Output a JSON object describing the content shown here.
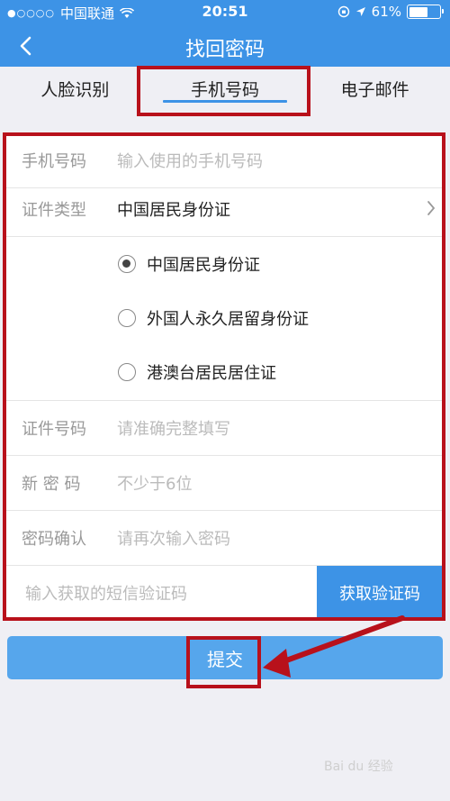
{
  "status_bar": {
    "carrier": "中国联通",
    "time": "20:51",
    "battery_percent": "61%",
    "battery_level": 0.61
  },
  "nav": {
    "title": "找回密码",
    "back_icon": "chevron-left-icon"
  },
  "tabs": [
    {
      "label": "人脸识别",
      "active": false
    },
    {
      "label": "手机号码",
      "active": true
    },
    {
      "label": "电子邮件",
      "active": false
    }
  ],
  "form": {
    "phone": {
      "label": "手机号码",
      "placeholder": "输入使用的手机号码"
    },
    "id_type": {
      "label": "证件类型",
      "value": "中国居民身份证"
    },
    "id_options": [
      {
        "label": "中国居民身份证",
        "selected": true
      },
      {
        "label": "外国人永久居留身份证",
        "selected": false
      },
      {
        "label": "港澳台居民居住证",
        "selected": false
      }
    ],
    "id_number": {
      "label": "证件号码",
      "placeholder": "请准确完整填写"
    },
    "new_password": {
      "label": "新 密 码",
      "placeholder": "不少于6位"
    },
    "confirm_password": {
      "label": "密码确认",
      "placeholder": "请再次输入密码"
    },
    "sms_code": {
      "placeholder": "输入获取的短信验证码",
      "button_label": "获取验证码"
    }
  },
  "submit_label": "提交",
  "watermark": "Bai du 经验",
  "colors": {
    "accent": "#3d93e6",
    "highlight": "#b8111b"
  }
}
